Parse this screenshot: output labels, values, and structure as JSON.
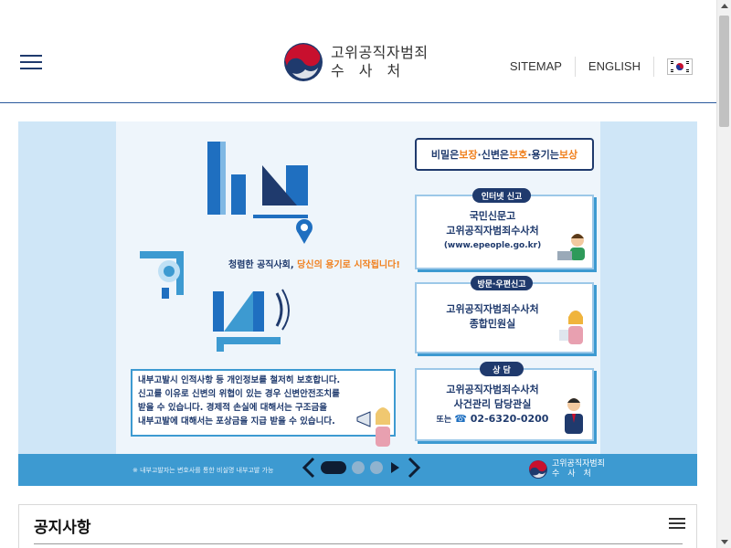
{
  "header": {
    "logo_line1": "고위공직자범죄",
    "logo_line2": "수사처",
    "links": [
      "SITEMAP",
      "ENGLISH"
    ],
    "flag_icon": "korea-flag-icon"
  },
  "banner": {
    "headline_parts": [
      "비밀은 ",
      "보장",
      "·신변은 ",
      "보호",
      "·용기는 ",
      "보상"
    ],
    "slogan_prefix": "청렴한 공직사회, ",
    "slogan_highlight": "당신의 용기로 시작됩니다!",
    "cards": [
      {
        "pill": "인터넷 신고",
        "lines": [
          "국민신문고",
          "고위공직자범죄수사처",
          "(www.epeople.go.kr)"
        ]
      },
      {
        "pill": "방문·우편신고",
        "lines": [
          "고위공직자범죄수사처",
          "종합민원실"
        ]
      },
      {
        "pill": "상 담",
        "lines": [
          "고위공직자범죄수사처",
          "사건관리 담당관실"
        ],
        "phone_prefix": "또는 ",
        "phone": "02-6320-0200"
      }
    ],
    "protect_lines": [
      "내부고발시 인적사항 등 개인정보를 철저히 보호합니다.",
      "신고를 이유로 신변의 위협이 있는 경우 신변안전조치를",
      "받을 수 있습니다.  경제적 손실에 대해서는 구조금을",
      "내부고발에 대해서는 포상금을 지급 받을 수 있습니다."
    ],
    "note": "※ 내부고발자는 변호사를 통한 비실명 내부고발 가능",
    "footer_logo_line1": "고위공직자범죄",
    "footer_logo_line2": "수사처",
    "slider": {
      "total": 3,
      "active": 1
    }
  },
  "notice": {
    "title": "공지사항"
  },
  "colors": {
    "navy": "#1f3a6d",
    "accent_blue": "#3d9ad1",
    "accent_orange": "#f0801e",
    "banner_bg": "#cfe6f7"
  }
}
